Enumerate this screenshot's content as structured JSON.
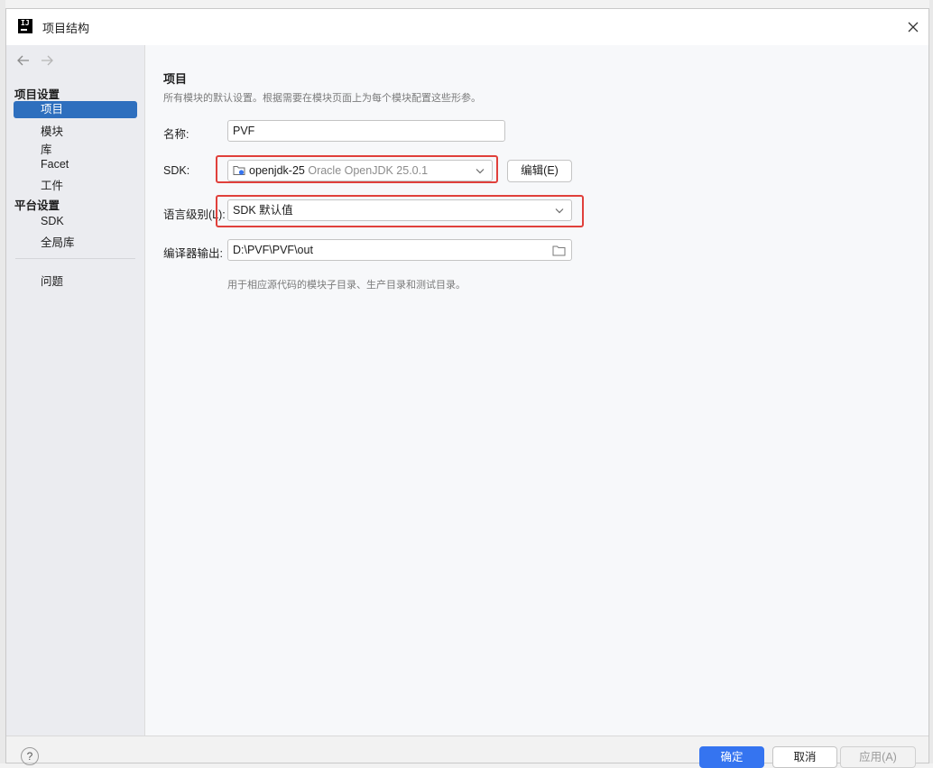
{
  "window": {
    "title": "项目结构"
  },
  "sidebar": {
    "sections": [
      {
        "title": "项目设置",
        "items": [
          "项目",
          "模块",
          "库",
          "Facet",
          "工件"
        ]
      },
      {
        "title": "平台设置",
        "items": [
          "SDK",
          "全局库"
        ]
      }
    ],
    "extra_items": [
      "问题"
    ],
    "selected": "项目"
  },
  "content": {
    "heading": "项目",
    "description": "所有模块的默认设置。根据需要在模块页面上为每个模块配置这些形参。",
    "name_label": "名称:",
    "name_value": "PVF",
    "sdk_label": "SDK:",
    "sdk_name": "openjdk-25",
    "sdk_detail": "Oracle OpenJDK 25.0.1",
    "sdk_edit_button": "编辑(E)",
    "language_label": "语言级别(L):",
    "language_value": "SDK 默认值",
    "output_label": "编译器输出:",
    "output_value": "D:\\PVF\\PVF\\out",
    "output_hint": "用于相应源代码的模块子目录、生产目录和测试目录。"
  },
  "footer": {
    "help": "?",
    "ok": "确定",
    "cancel": "取消",
    "apply": "应用(A)"
  },
  "colors": {
    "selection": "#2e6fbe",
    "primary_button": "#3574f0",
    "highlight_box": "#e0403b"
  }
}
